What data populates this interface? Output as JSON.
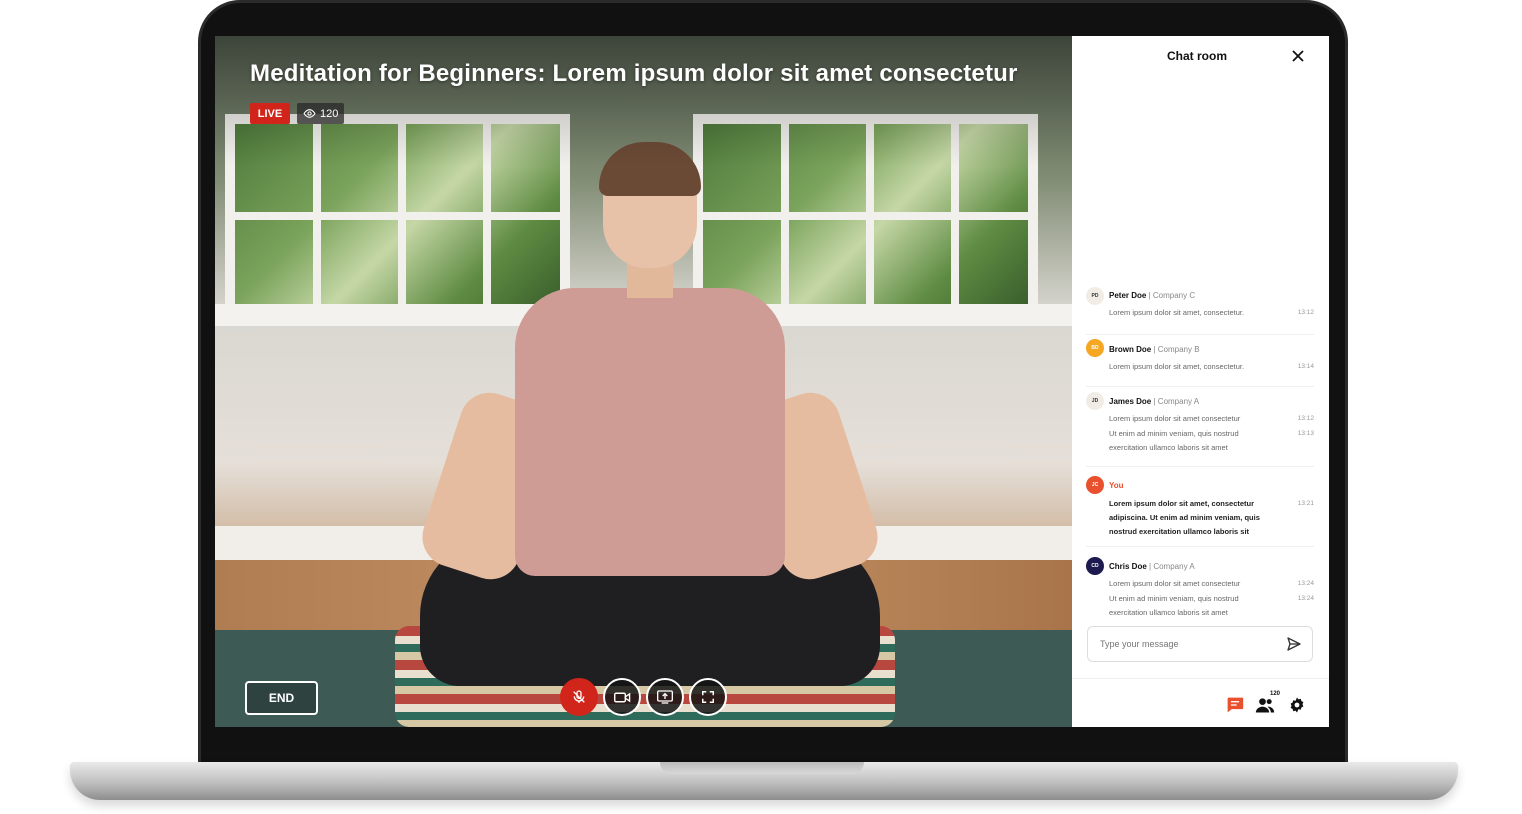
{
  "stream": {
    "title": "Meditation for Beginners: Lorem ipsum dolor sit amet consectetur",
    "live_label": "LIVE",
    "viewer_count": "120"
  },
  "controls": {
    "end_label": "END"
  },
  "chat": {
    "title": "Chat room",
    "messages": [
      {
        "initials": "PD",
        "name": "Peter Doe",
        "company": "| Company C",
        "lines": [
          "Lorem ipsum dolor sit amet, consectetur."
        ],
        "times": [
          "13:12"
        ]
      },
      {
        "initials": "BD",
        "name": "Brown Doe",
        "company": "| Company B",
        "lines": [
          "Lorem ipsum dolor sit amet, consectetur."
        ],
        "times": [
          "13:14"
        ]
      },
      {
        "initials": "JD",
        "name": "James Doe",
        "company": "| Company A",
        "lines": [
          "Lorem ipsum dolor sit amet consectetur",
          "Ut enim ad minim veniam, quis nostrud",
          "exercitation ullamco laboris sit amet"
        ],
        "times": [
          "13:12",
          "13:13"
        ]
      },
      {
        "initials": "JC",
        "name": "You",
        "company": "",
        "lines": [
          "Lorem ipsum dolor sit amet, consectetur",
          "adipiscina. Ut enim ad minim veniam, quis",
          "nostrud exercitation ullamco laboris sit"
        ],
        "times": [
          "13:21"
        ]
      },
      {
        "initials": "CD",
        "name": "Chris Doe",
        "company": "| Company A",
        "lines": [
          "Lorem ipsum dolor sit amet consectetur",
          "Ut enim ad minim veniam, quis nostrud",
          "exercitation ullamco laboris sit amet"
        ],
        "times": [
          "13:24",
          "13:24"
        ]
      }
    ],
    "input_placeholder": "Type your message",
    "participants_count": "120"
  },
  "colors": {
    "live_red": "#d1251b",
    "accent_orange": "#e8502e",
    "avatar_orange": "#f5a623",
    "avatar_navy": "#1c1a4e"
  }
}
